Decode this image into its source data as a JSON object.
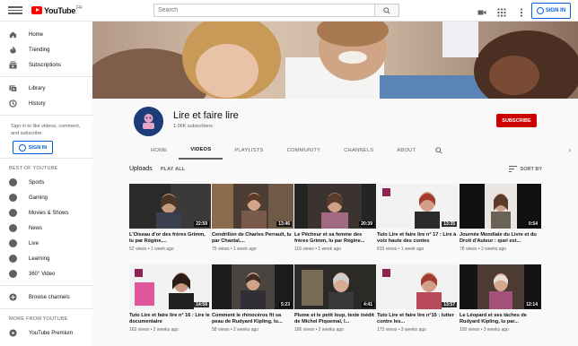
{
  "topbar": {
    "logo_text": "YouTube",
    "logo_region": "FR",
    "search_placeholder": "Search",
    "signin_label": "SIGN IN"
  },
  "sidebar": {
    "main": [
      {
        "label": "Home",
        "icon": "home-icon"
      },
      {
        "label": "Trending",
        "icon": "flame-icon"
      },
      {
        "label": "Subscriptions",
        "icon": "subscriptions-icon"
      }
    ],
    "library": [
      {
        "label": "Library",
        "icon": "library-icon"
      },
      {
        "label": "History",
        "icon": "history-icon"
      }
    ],
    "signin_prompt": "Sign in to like videos, comment, and subscribe.",
    "signin_label": "SIGN IN",
    "best_heading": "BEST OF YOUTUBE",
    "best": [
      {
        "label": "Sports",
        "icon": "sports-icon"
      },
      {
        "label": "Gaming",
        "icon": "gaming-icon"
      },
      {
        "label": "Movies & Shows",
        "icon": "movies-icon"
      },
      {
        "label": "News",
        "icon": "news-icon"
      },
      {
        "label": "Live",
        "icon": "live-icon"
      },
      {
        "label": "Learning",
        "icon": "learning-icon"
      },
      {
        "label": "360° Video",
        "icon": "360-video-icon"
      }
    ],
    "browse_label": "Browse channels",
    "more_heading": "MORE FROM YOUTUBE",
    "premium_label": "YouTube Premium"
  },
  "channel": {
    "name": "Lire et faire lire",
    "subscribers": "1.06K subscribers",
    "subscribe_label": "SUBSCRIBE",
    "tabs": [
      "HOME",
      "VIDEOS",
      "PLAYLISTS",
      "COMMUNITY",
      "CHANNELS",
      "ABOUT"
    ],
    "active_tab": "VIDEOS"
  },
  "uploads": {
    "title": "Uploads",
    "play_all": "PLAY ALL",
    "sort_by": "SORT BY"
  },
  "videos": [
    {
      "title": "L'Oiseau d'or des frères Grimm, lu par Régine,...",
      "meta": "52 views • 1 week ago",
      "duration": "22:59"
    },
    {
      "title": "Cendrillon de Charles Perrault, lu par Chantal,...",
      "meta": "75 views • 1 week ago",
      "duration": "13:46"
    },
    {
      "title": "Le Pêcheur et sa femme des frères Grimm, lu par Régine...",
      "meta": "116 views • 1 week ago",
      "duration": "20:39"
    },
    {
      "title": "Tuto Lire et faire lire n° 17 : Lire à voix haute des contes",
      "meta": "815 views • 1 week ago",
      "duration": "13:35"
    },
    {
      "title": "Journée Mondiale du Livre et du Droit d'Auteur : quel est...",
      "meta": "78 views • 2 weeks ago",
      "duration": "0:54"
    },
    {
      "title": "Tuto Lire et faire lire n° 16 : Lire le documentaire",
      "meta": "163 views • 2 weeks ago",
      "duration": "14:58"
    },
    {
      "title": "Comment le rhinocéros fit sa peau de Rudyard Kipling, lu...",
      "meta": "58 views • 2 weeks ago",
      "duration": "5:23"
    },
    {
      "title": "Plume et le petit loup, texte inédit de Michel Piquemal, l...",
      "meta": "186 views • 2 weeks ago",
      "duration": "4:41"
    },
    {
      "title": "Tuto Lire et faire lire n°15 : lutter contre les...",
      "meta": "173 views • 3 weeks ago",
      "duration": "13:57"
    },
    {
      "title": "Le Léopard et ses tâches de Rudyard Kipling, lu par...",
      "meta": "150 views • 3 weeks ago",
      "duration": "12:14"
    }
  ]
}
